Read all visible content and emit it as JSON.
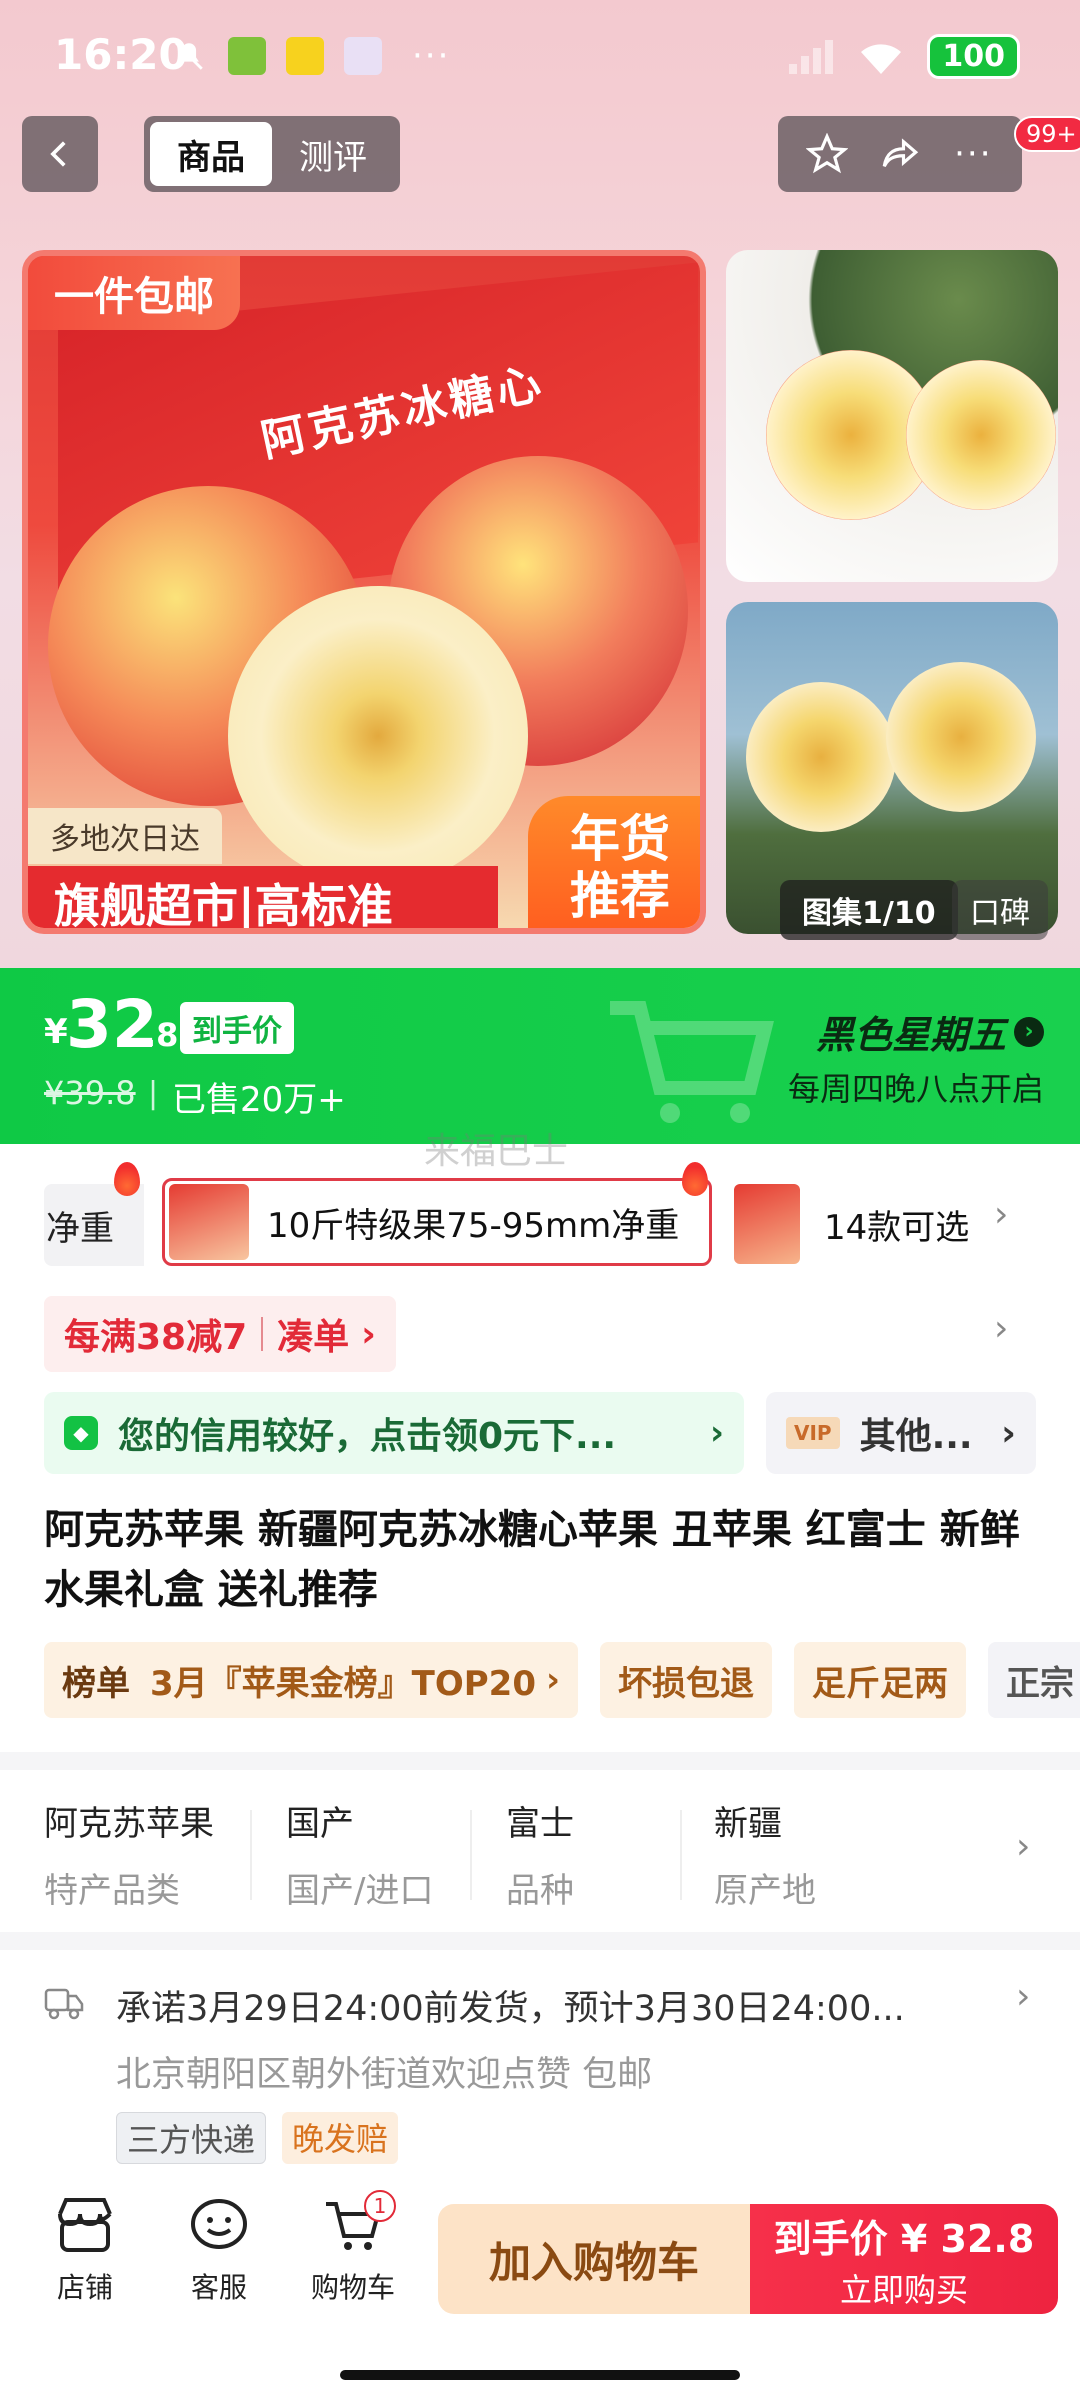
{
  "status_bar": {
    "time": "16:20",
    "battery": "100"
  },
  "nav": {
    "tabs": [
      "商品",
      "测评"
    ],
    "active_tab": 0,
    "badge": "99+"
  },
  "gallery": {
    "promo_tag": "一件包邮",
    "location_tag": "多地次日达",
    "banner": "旗舰超市|高标准",
    "corner_banner_l1": "年货",
    "corner_banner_l2": "推荐",
    "box_text": "阿克苏冰糖心",
    "count": "图集1/10",
    "review_tab": "口碑"
  },
  "price": {
    "currency": "¥",
    "integer": "32",
    "decimal": ".8",
    "final_tag": "到手价",
    "original": "¥39.8",
    "sold": "已售20万+",
    "event_title": "黑色星期五",
    "event_sub": "每周四晚八点开启",
    "brand_color": "#19d04e"
  },
  "watermark": "来福巴士",
  "sku": {
    "left_partial": "净重",
    "selected": "10斤特级果75-95mm净重",
    "count": "14款可选"
  },
  "discount": {
    "text": "每满38减7",
    "link": "凑单"
  },
  "credit": {
    "text": "您的信用较好，点击领0元下...",
    "other_label": "其他...",
    "vip": "VIP"
  },
  "title": "阿克苏苹果 新疆阿克苏冰糖心苹果 丑苹果 红富士 新鲜水果礼盒 送礼推荐",
  "tags": {
    "ranking_label": "榜单",
    "ranking_text": "3月『苹果金榜』TOP20",
    "t1": "坏损包退",
    "t2": "足斤足两",
    "t3": "正宗"
  },
  "attrs": [
    {
      "value": "阿克苏苹果",
      "key": "特产品类"
    },
    {
      "value": "国产",
      "key": "国产/进口"
    },
    {
      "value": "富士",
      "key": "品种"
    },
    {
      "value": "新疆",
      "key": "原产地"
    }
  ],
  "shipping": {
    "line1": "承诺3月29日24:00前发货，预计3月30日24:00...",
    "line2": "北京朝阳区朝外街道欢迎点赞  包邮",
    "badge1": "三方快递",
    "badge2": "晚发赔"
  },
  "bottom": {
    "store": "店铺",
    "service": "客服",
    "cart": "购物车",
    "cart_count": "1",
    "add_cart": "加入购物车",
    "buy_price": "到手价 ¥ 32.8",
    "buy_label": "立即购买"
  }
}
